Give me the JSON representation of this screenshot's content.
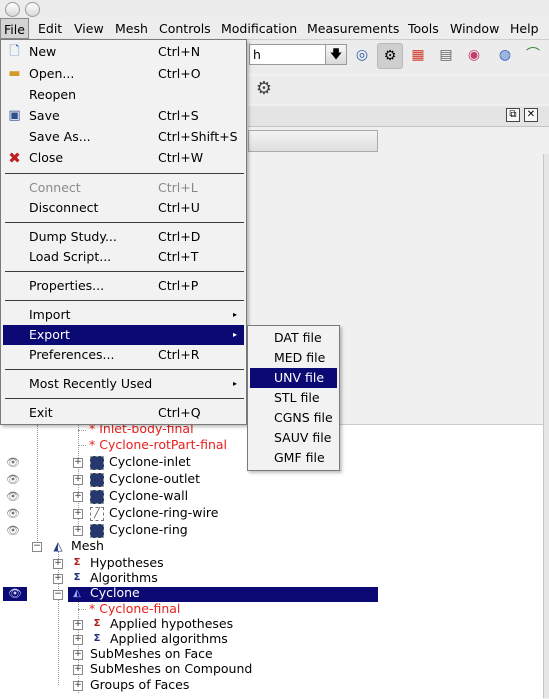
{
  "menubar": {
    "items": [
      "File",
      "Edit",
      "View",
      "Mesh",
      "Controls",
      "Modification",
      "Measurements",
      "Tools",
      "Window",
      "Help"
    ]
  },
  "toolbar": {
    "combo_value": "h"
  },
  "file_menu": {
    "items": [
      {
        "label": "New",
        "shortcut": "Ctrl+N",
        "icon": "new-document-icon"
      },
      {
        "label": "Open...",
        "shortcut": "Ctrl+O",
        "icon": "open-folder-icon"
      },
      {
        "label": "Reopen",
        "shortcut": ""
      },
      {
        "label": "Save",
        "shortcut": "Ctrl+S",
        "icon": "save-disk-icon"
      },
      {
        "label": "Save As...",
        "shortcut": "Ctrl+Shift+S"
      },
      {
        "label": "Close",
        "shortcut": "Ctrl+W",
        "icon": "close-x-icon"
      },
      {
        "label": "Connect",
        "shortcut": "Ctrl+L",
        "disabled": true
      },
      {
        "label": "Disconnect",
        "shortcut": "Ctrl+U"
      },
      {
        "label": "Dump Study...",
        "shortcut": "Ctrl+D"
      },
      {
        "label": "Load Script...",
        "shortcut": "Ctrl+T"
      },
      {
        "label": "Properties...",
        "shortcut": "Ctrl+P"
      },
      {
        "label": "Import",
        "shortcut": "",
        "submenu": true
      },
      {
        "label": "Export",
        "shortcut": "",
        "submenu": true,
        "highlighted": true
      },
      {
        "label": "Preferences...",
        "shortcut": "Ctrl+R"
      },
      {
        "label": "Most Recently Used",
        "shortcut": "",
        "submenu": true
      },
      {
        "label": "Exit",
        "shortcut": "Ctrl+Q"
      }
    ]
  },
  "export_menu": {
    "items": [
      {
        "label": "DAT file"
      },
      {
        "label": "MED file"
      },
      {
        "label": "UNV file",
        "highlighted": true
      },
      {
        "label": "STL file"
      },
      {
        "label": "CGNS file"
      },
      {
        "label": "SAUV file"
      },
      {
        "label": "GMF file"
      }
    ]
  },
  "tree": {
    "rows": [
      {
        "label": "* Inlet-body-final",
        "red": true
      },
      {
        "label": "* Cyclone-rotPart-final",
        "red": true
      },
      {
        "label": "Cyclone-inlet",
        "icon": "group-icon"
      },
      {
        "label": "Cyclone-outlet",
        "icon": "group-icon"
      },
      {
        "label": "Cyclone-wall",
        "icon": "group-icon"
      },
      {
        "label": "Cyclone-ring-wire",
        "icon": "wire-group-icon"
      },
      {
        "label": "Cyclone-ring",
        "icon": "group-icon"
      },
      {
        "label": "Mesh",
        "icon": "mesh-component-icon"
      },
      {
        "label": "Hypotheses",
        "icon": "hypotheses-icon"
      },
      {
        "label": "Algorithms",
        "icon": "algorithms-icon"
      },
      {
        "label": "Cyclone",
        "icon": "mesh-object-icon",
        "selected": true
      },
      {
        "label": "* Cyclone-final",
        "red": true
      },
      {
        "label": "Applied hypotheses",
        "icon": "hypotheses-icon"
      },
      {
        "label": "Applied algorithms",
        "icon": "algorithms-icon"
      },
      {
        "label": "SubMeshes on Face"
      },
      {
        "label": "SubMeshes on Compound"
      },
      {
        "label": "Groups of Faces"
      }
    ]
  },
  "colors": {
    "highlight": "#0b0a74",
    "red_text": "#e8201c"
  }
}
